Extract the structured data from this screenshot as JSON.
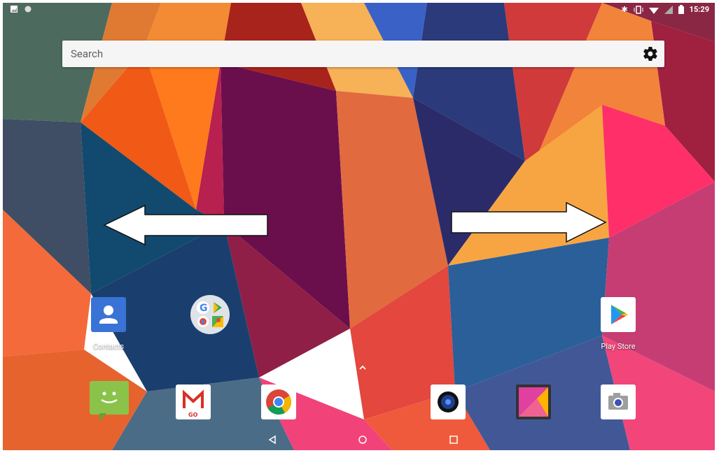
{
  "status_bar": {
    "time": "15:29",
    "left_icons": [
      "image-notification-icon",
      "circle-notification-icon"
    ],
    "right_icons": [
      "bluetooth-icon",
      "vibrate-icon",
      "wifi-icon",
      "signal-icon",
      "battery-icon"
    ]
  },
  "search": {
    "placeholder": "Search",
    "settings_icon": "gear-icon"
  },
  "home_apps": [
    {
      "label": "Contacts",
      "icon": "contacts-icon"
    },
    {
      "label": "",
      "icon": "google-apps-folder-icon"
    },
    {
      "label": "Play Store",
      "icon": "play-store-icon"
    }
  ],
  "dock": [
    {
      "name": "messaging",
      "icon": "messaging-icon"
    },
    {
      "name": "gmail-go",
      "icon": "gmail-go-icon",
      "badge": "GO"
    },
    {
      "name": "chrome",
      "icon": "chrome-icon"
    },
    {
      "name": "music",
      "icon": "music-speaker-icon"
    },
    {
      "name": "gallery",
      "icon": "gallery-icon"
    },
    {
      "name": "camera",
      "icon": "camera-icon"
    }
  ],
  "navigation": {
    "back": "back-icon",
    "home": "home-icon",
    "recents": "recents-icon"
  },
  "overlay_arrows": [
    "left-arrow",
    "right-arrow"
  ],
  "colors": {
    "search_bg": "#f5f5f5",
    "accent": "#ffffff"
  }
}
